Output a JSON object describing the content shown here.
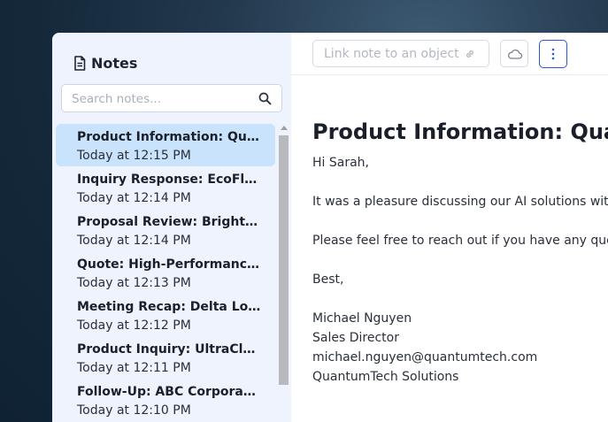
{
  "sidebar": {
    "title": "Notes",
    "search_placeholder": "Search notes...",
    "notes": [
      {
        "title": "Product Information: QuantumTech",
        "time": "Today at 12:15 PM"
      },
      {
        "title": "Inquiry Response: EcoFlow Systems",
        "time": "Today at 12:14 PM"
      },
      {
        "title": "Proposal Review: Brightline Partners",
        "time": "Today at 12:14 PM"
      },
      {
        "title": "Quote: High-Performance Servers",
        "time": "Today at 12:13 PM"
      },
      {
        "title": "Meeting Recap: Delta Logistics",
        "time": "Today at 12:12 PM"
      },
      {
        "title": "Product Inquiry: UltraClean Solutions",
        "time": "Today at 12:11 PM"
      },
      {
        "title": "Follow-Up: ABC Corporation",
        "time": "Today at 12:10 PM"
      }
    ]
  },
  "toolbar": {
    "link_label": "Link note to an object"
  },
  "note": {
    "title": "Product Information: QuantumTech",
    "greeting": "Hi Sarah,",
    "body1": "It was a pleasure discussing our AI solutions with you",
    "body2": "Please feel free to reach out if you have any questions.",
    "closing": "Best,",
    "sig_name": "Michael Nguyen",
    "sig_title": "Sales Director",
    "sig_email": "michael.nguyen@quantumtech.com",
    "sig_company": "QuantumTech Solutions"
  },
  "colors": {
    "accent": "#2f55d4",
    "selected_bg": "#c8e3fb",
    "sidebar_bg": "#eef3fd"
  }
}
